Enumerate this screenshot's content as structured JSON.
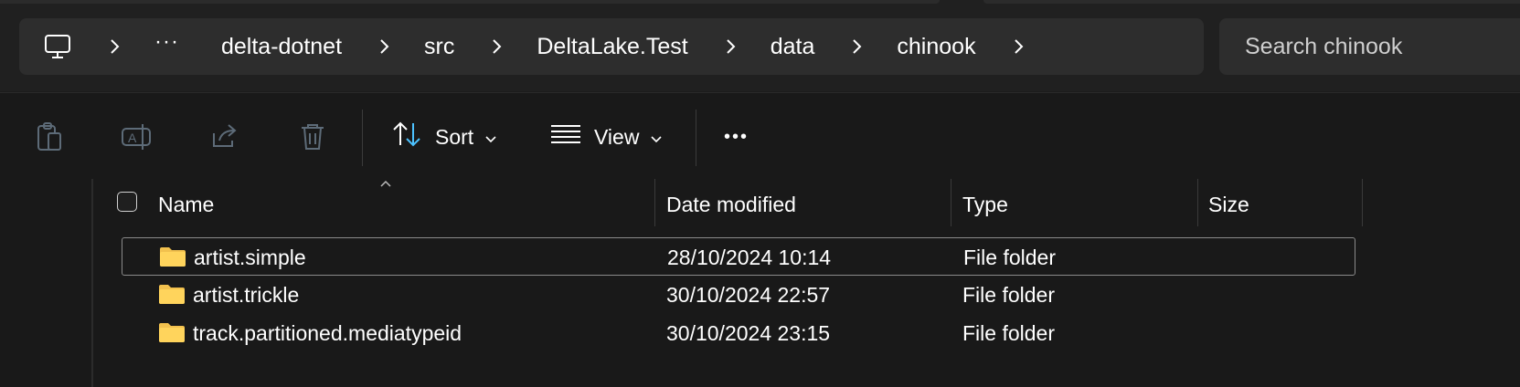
{
  "address": {
    "root_icon": "computer-icon",
    "overflow": "···",
    "crumbs": [
      "delta-dotnet",
      "src",
      "DeltaLake.Test",
      "data",
      "chinook"
    ]
  },
  "search": {
    "placeholder": "Search chinook"
  },
  "toolbar": {
    "icons": [
      "clipboard-icon",
      "rename-icon",
      "share-icon",
      "delete-icon"
    ],
    "sort_label": "Sort",
    "view_label": "View",
    "more_label": "•••"
  },
  "columns": {
    "name": "Name",
    "date": "Date modified",
    "type": "Type",
    "size": "Size"
  },
  "files": [
    {
      "name": "artist.simple",
      "date": "28/10/2024 10:14",
      "type": "File folder",
      "size": "",
      "selected": true
    },
    {
      "name": "artist.trickle",
      "date": "30/10/2024 22:57",
      "type": "File folder",
      "size": ""
    },
    {
      "name": "track.partitioned.mediatypeid",
      "date": "30/10/2024 23:15",
      "type": "File folder",
      "size": ""
    }
  ],
  "colors": {
    "background": "#191919",
    "folder": "#f2c14e",
    "accent": "#4cc2ff"
  }
}
